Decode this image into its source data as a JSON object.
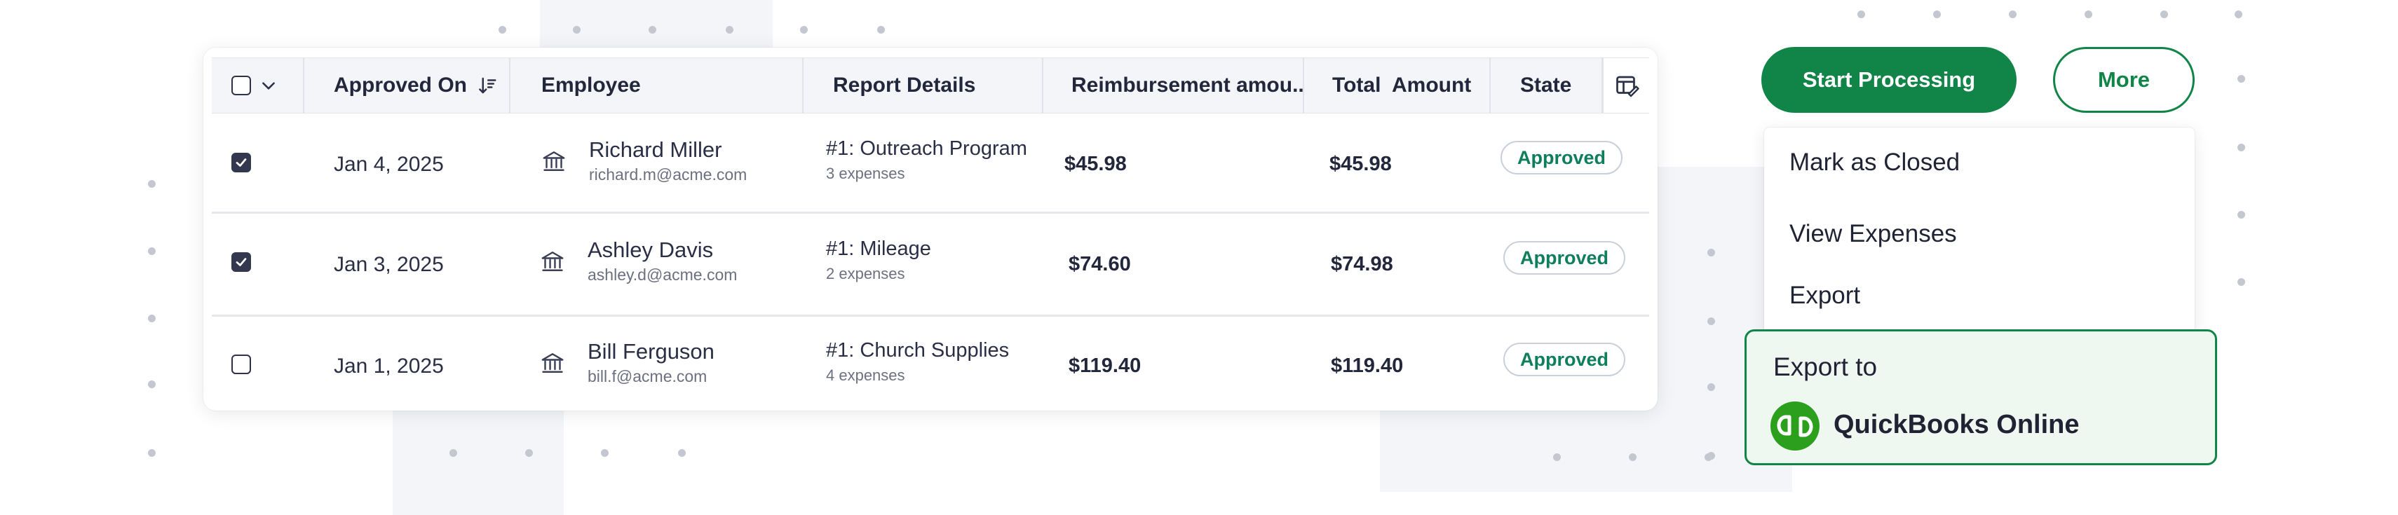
{
  "table": {
    "columns": {
      "select": "",
      "approved_on": "Approved On",
      "employee": "Employee",
      "report_details": "Report Details",
      "reimbursement_amount": "Reimbursement amou..",
      "total_amount": "Total  Amount",
      "state": "State"
    },
    "rows": [
      {
        "checked": true,
        "approved_on": "Jan 4, 2025",
        "employee_name": "Richard Miller",
        "employee_email": "richard.m@acme.com",
        "report_title": "#1: Outreach Program",
        "report_expenses": "3 expenses",
        "reimbursement": "$45.98",
        "total": "$45.98",
        "state": "Approved"
      },
      {
        "checked": true,
        "approved_on": "Jan 3, 2025",
        "employee_name": "Ashley Davis",
        "employee_email": "ashley.d@acme.com",
        "report_title": "#1: Mileage",
        "report_expenses": "2 expenses",
        "reimbursement": "$74.60",
        "total": "$74.98",
        "state": "Approved"
      },
      {
        "checked": false,
        "approved_on": "Jan 1, 2025",
        "employee_name": "Bill Ferguson",
        "employee_email": "bill.f@acme.com",
        "report_title": "#1: Church Supplies",
        "report_expenses": "4 expenses",
        "reimbursement": "$119.40",
        "total": "$119.40",
        "state": "Approved"
      }
    ]
  },
  "actions": {
    "start_processing": "Start Processing",
    "more": "More"
  },
  "menu": {
    "items": [
      "Mark as Closed",
      "View Expenses",
      "Export"
    ]
  },
  "export": {
    "title": "Export to",
    "target": "QuickBooks Online"
  },
  "icons": {
    "sort": "sort-descending-icon",
    "columns": "column-settings-icon",
    "bank": "bank-icon",
    "quickbooks": "quickbooks-logo"
  },
  "colors": {
    "accent": "#118548",
    "badge_text": "#0e7e5c",
    "checkbox_checked": "#34384f",
    "header_bg": "#f4f5f8",
    "export_bg": "#eef8f1"
  }
}
